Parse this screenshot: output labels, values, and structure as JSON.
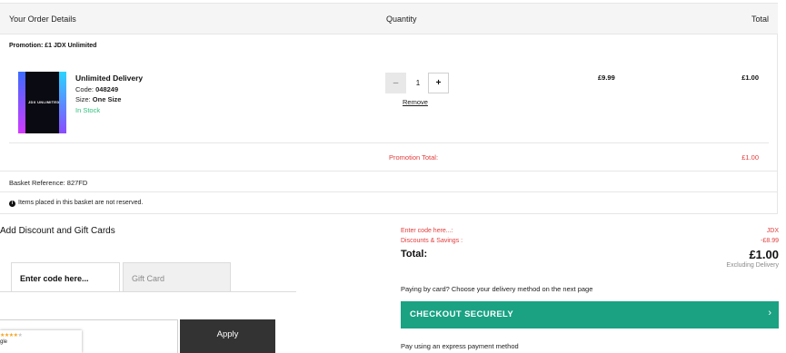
{
  "order": {
    "headers": {
      "details": "Your Order Details",
      "quantity": "Quantity",
      "total": "Total"
    },
    "promotion_line": "Promotion: £1 JDX Unlimited",
    "item": {
      "image_logo_text": "JDX UNLIMITED",
      "name": "Unlimited Delivery",
      "code_label": "Code:",
      "code": "048249",
      "size_label": "Size:",
      "size": "One Size",
      "stock": "In Stock",
      "quantity": "1",
      "minus": "–",
      "plus": "+",
      "remove": "Remove",
      "price": "£9.99",
      "total": "£1.00"
    },
    "promotion_total_label": "Promotion Total:",
    "promotion_total_value": "£1.00",
    "basket_reference": "Basket Reference: 827FD",
    "reserve_note": "Items placed in this basket are not reserved.",
    "info_icon": "info-icon"
  },
  "discount": {
    "title": "Add Discount and Gift Cards",
    "tabs": [
      "Enter code here...",
      "Gift Card"
    ],
    "apply": "Apply",
    "google_badge": {
      "stars": "★★★★",
      "dim_star": "★",
      "label": "gle"
    }
  },
  "summary": {
    "code_label": "Enter code here...:",
    "code_value": "JDX",
    "savings_label": "Discounts & Savings :",
    "savings_value": "-£8.99",
    "total_label": "Total:",
    "total_value": "£1.00",
    "excluding": "Excluding Delivery",
    "paying_by_card": "Paying by card? Choose your delivery method on the next page",
    "checkout": "CHECKOUT SECURELY",
    "checkout_chevron": "›",
    "express": "Pay using an express payment method"
  },
  "colors": {
    "accent_green": "#1aa283",
    "promo_red": "#e23c3c",
    "stock_green": "#2fc07e",
    "apply_dark": "#333333"
  }
}
